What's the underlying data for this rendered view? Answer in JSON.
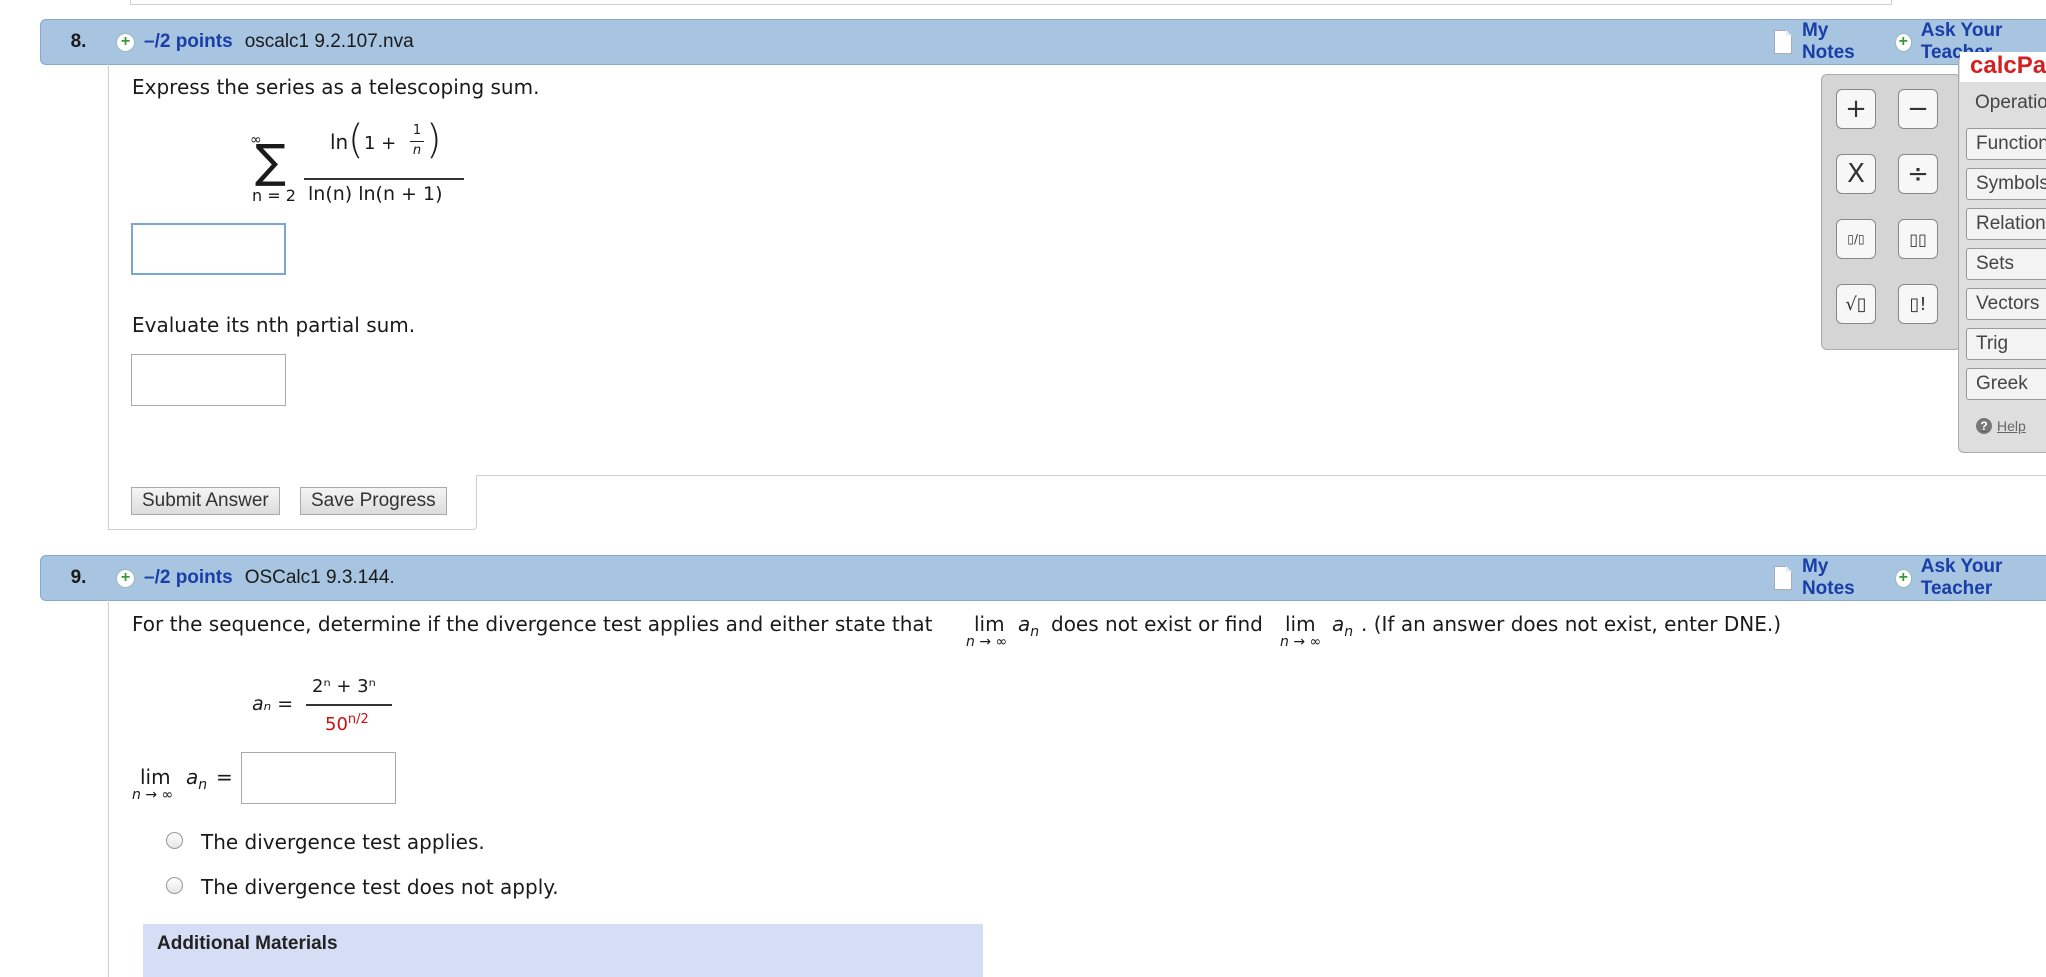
{
  "q8": {
    "number": "8.",
    "points": "–/2 points",
    "source": "oscalc1 9.2.107.nva",
    "my_notes": "My Notes",
    "ask_teacher": "Ask Your Teacher",
    "prompt1": "Express the series as a telescoping sum.",
    "series": {
      "sigma": "∑",
      "upper": "∞",
      "lower": "n = 2",
      "num_ln": "ln",
      "num_one": "1 +",
      "frac_num": "1",
      "frac_den": "n",
      "denominator": "ln(n) ln(n + 1)"
    },
    "prompt2": "Evaluate its nth partial sum.",
    "submit": "Submit Answer",
    "save": "Save Progress"
  },
  "q9": {
    "number": "9.",
    "points": "–/2 points",
    "source": "OSCalc1 9.3.144.",
    "my_notes": "My Notes",
    "ask_teacher": "Ask Your Teacher",
    "prompt_a": "For the sequence, determine if the divergence test applies and either state that",
    "prompt_b": "does not exist or find",
    "prompt_c": ". (If an answer does not exist, enter DNE.)",
    "lim": "lim",
    "lim_sub": "n → ∞",
    "a_n": "a",
    "n_sub": "n",
    "formula": {
      "lhs": "aₙ =",
      "num": "2ⁿ + 3ⁿ",
      "den_base": "50",
      "den_exp": "n/2"
    },
    "equals": "=",
    "options": [
      "The divergence test applies.",
      "The divergence test does not apply."
    ],
    "additional": "Additional Materials"
  },
  "calcpad": {
    "logo_a": "calc",
    "logo_b": "Pad",
    "keys": [
      "+",
      "−",
      "X",
      "÷",
      "▯/▯",
      "▯▯",
      "√▯",
      "▯!"
    ],
    "tabs": [
      "Operations",
      "Functions",
      "Symbols",
      "Relations",
      "Sets",
      "Vectors",
      "Trig",
      "Greek"
    ],
    "help": "Help"
  }
}
